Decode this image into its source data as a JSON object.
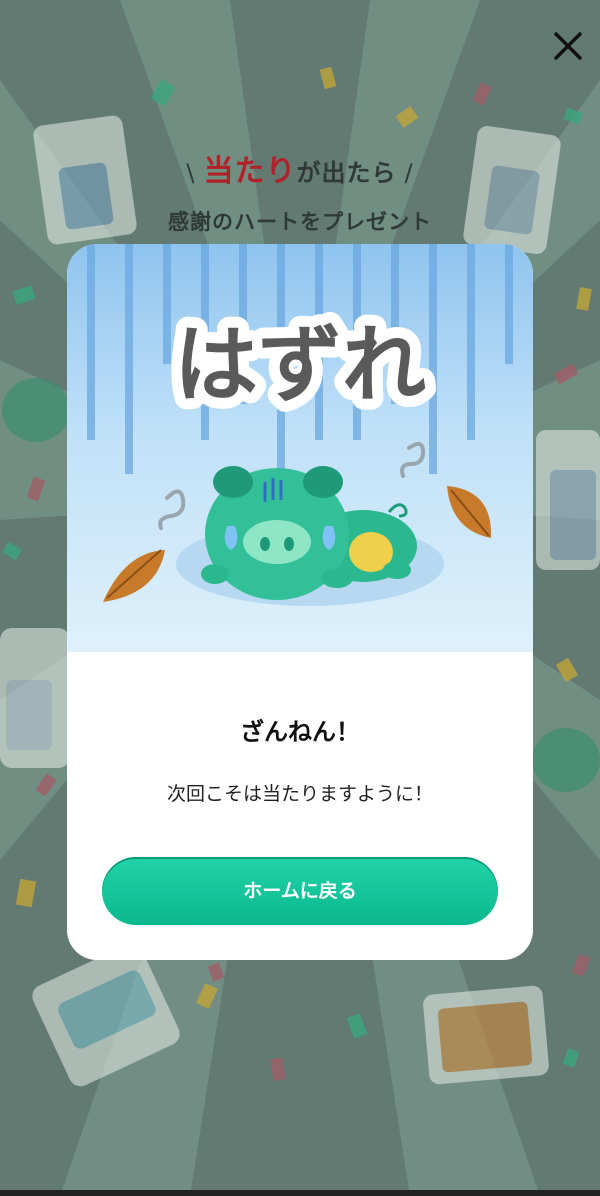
{
  "header": {
    "slash_left": "\\",
    "hit_word": "当たり",
    "hit_tail": "が出たら",
    "slash_right": "/",
    "subline": "感謝のハートをプレゼント"
  },
  "result": {
    "badge_text": "はずれ",
    "title": "ざんねん！",
    "message": "次回こそは当たりますように！",
    "home_button": "ホームに戻る"
  },
  "icons": {
    "close": "close-icon"
  },
  "colors": {
    "hit_red": "#b0222a",
    "button_green": "#12c79b",
    "overlay": "#5f706a"
  }
}
